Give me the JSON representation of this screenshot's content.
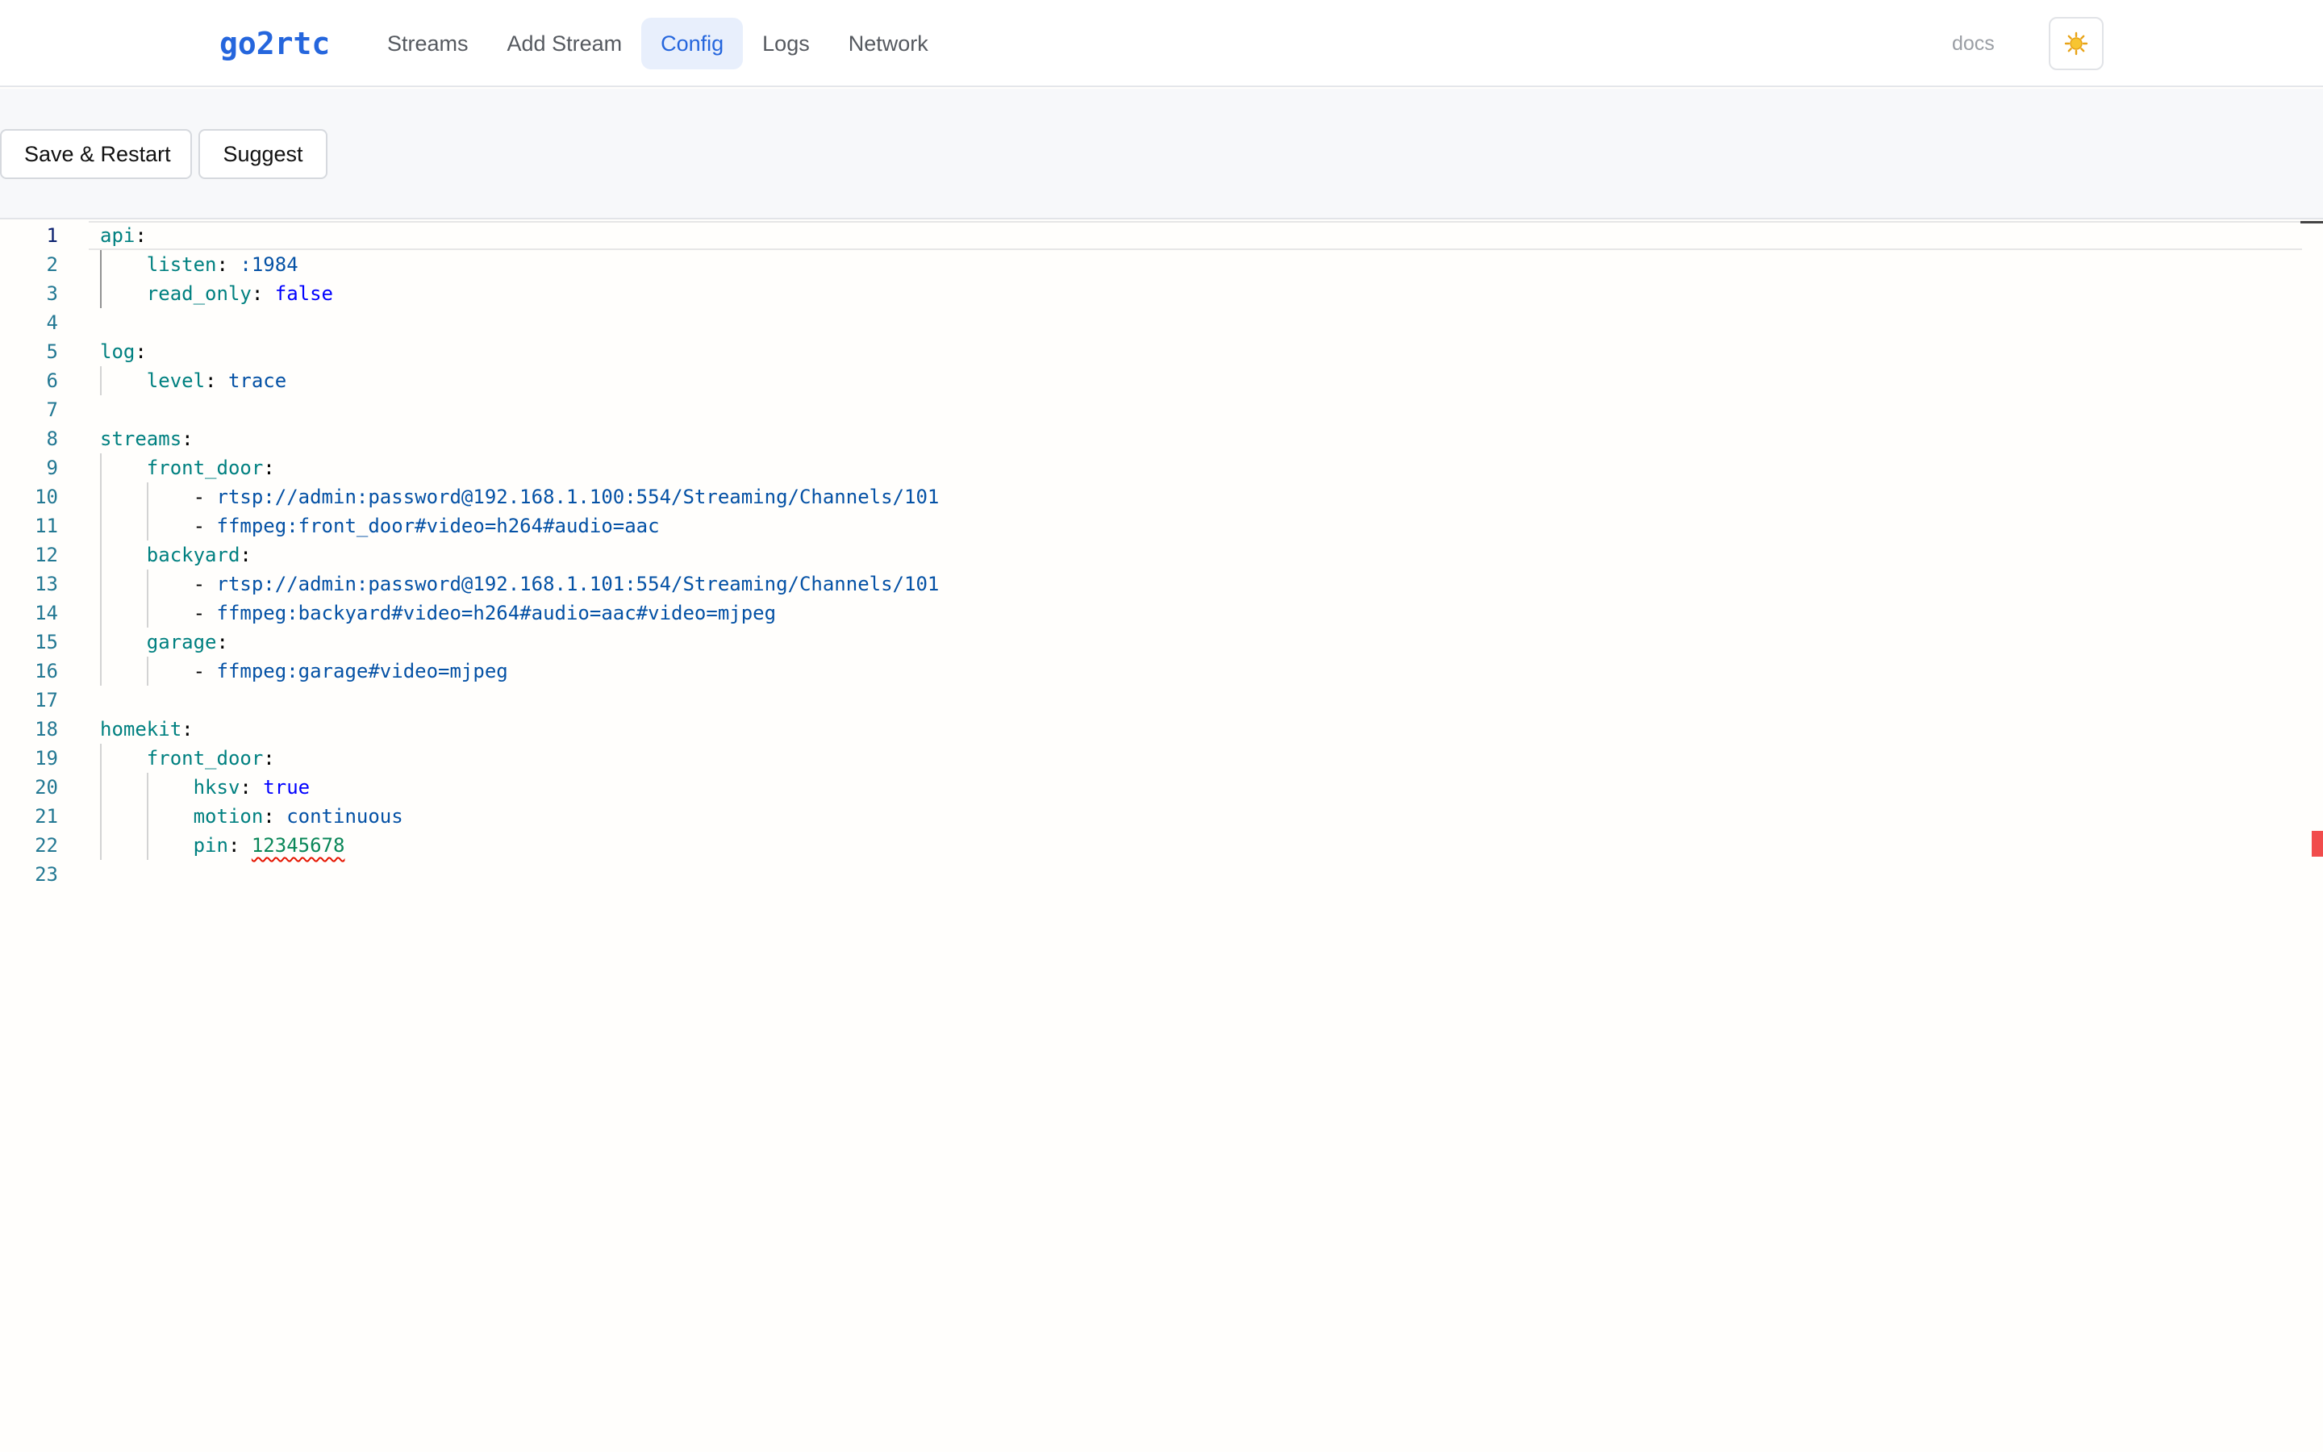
{
  "app": {
    "brand": "go2rtc"
  },
  "nav": {
    "items": [
      {
        "label": "Streams",
        "active": false
      },
      {
        "label": "Add Stream",
        "active": false
      },
      {
        "label": "Config",
        "active": true
      },
      {
        "label": "Logs",
        "active": false
      },
      {
        "label": "Network",
        "active": false
      }
    ],
    "docs_label": "docs",
    "theme_icon": "sun-icon"
  },
  "toolbar": {
    "save_label": "Save & Restart",
    "suggest_label": "Suggest"
  },
  "editor": {
    "current_line": 1,
    "error_line": 22,
    "lines": [
      {
        "n": "1",
        "indent": 0,
        "tokens": [
          {
            "t": "key",
            "v": "api"
          },
          {
            "t": "punc",
            "v": ":"
          }
        ]
      },
      {
        "n": "2",
        "indent": 1,
        "tokens": [
          {
            "t": "key",
            "v": "listen"
          },
          {
            "t": "punc",
            "v": ": "
          },
          {
            "t": "str",
            "v": ":1984"
          }
        ]
      },
      {
        "n": "3",
        "indent": 1,
        "tokens": [
          {
            "t": "key",
            "v": "read_only"
          },
          {
            "t": "punc",
            "v": ": "
          },
          {
            "t": "bool",
            "v": "false"
          }
        ]
      },
      {
        "n": "4",
        "indent": 0,
        "tokens": []
      },
      {
        "n": "5",
        "indent": 0,
        "tokens": [
          {
            "t": "key",
            "v": "log"
          },
          {
            "t": "punc",
            "v": ":"
          }
        ]
      },
      {
        "n": "6",
        "indent": 1,
        "tokens": [
          {
            "t": "key",
            "v": "level"
          },
          {
            "t": "punc",
            "v": ": "
          },
          {
            "t": "str",
            "v": "trace"
          }
        ]
      },
      {
        "n": "7",
        "indent": 0,
        "tokens": []
      },
      {
        "n": "8",
        "indent": 0,
        "tokens": [
          {
            "t": "key",
            "v": "streams"
          },
          {
            "t": "punc",
            "v": ":"
          }
        ]
      },
      {
        "n": "9",
        "indent": 1,
        "tokens": [
          {
            "t": "key",
            "v": "front_door"
          },
          {
            "t": "punc",
            "v": ":"
          }
        ]
      },
      {
        "n": "10",
        "indent": 2,
        "tokens": [
          {
            "t": "punc",
            "v": "- "
          },
          {
            "t": "str",
            "v": "rtsp://admin:password@192.168.1.100:554/Streaming/Channels/101"
          }
        ]
      },
      {
        "n": "11",
        "indent": 2,
        "tokens": [
          {
            "t": "punc",
            "v": "- "
          },
          {
            "t": "str",
            "v": "ffmpeg:front_door#video=h264#audio=aac"
          }
        ]
      },
      {
        "n": "12",
        "indent": 1,
        "tokens": [
          {
            "t": "key",
            "v": "backyard"
          },
          {
            "t": "punc",
            "v": ":"
          }
        ]
      },
      {
        "n": "13",
        "indent": 2,
        "tokens": [
          {
            "t": "punc",
            "v": "- "
          },
          {
            "t": "str",
            "v": "rtsp://admin:password@192.168.1.101:554/Streaming/Channels/101"
          }
        ]
      },
      {
        "n": "14",
        "indent": 2,
        "tokens": [
          {
            "t": "punc",
            "v": "- "
          },
          {
            "t": "str",
            "v": "ffmpeg:backyard#video=h264#audio=aac#video=mjpeg"
          }
        ]
      },
      {
        "n": "15",
        "indent": 1,
        "tokens": [
          {
            "t": "key",
            "v": "garage"
          },
          {
            "t": "punc",
            "v": ":"
          }
        ]
      },
      {
        "n": "16",
        "indent": 2,
        "tokens": [
          {
            "t": "punc",
            "v": "- "
          },
          {
            "t": "str",
            "v": "ffmpeg:garage#video=mjpeg"
          }
        ]
      },
      {
        "n": "17",
        "indent": 0,
        "tokens": []
      },
      {
        "n": "18",
        "indent": 0,
        "tokens": [
          {
            "t": "key",
            "v": "homekit"
          },
          {
            "t": "punc",
            "v": ":"
          }
        ]
      },
      {
        "n": "19",
        "indent": 1,
        "tokens": [
          {
            "t": "key",
            "v": "front_door"
          },
          {
            "t": "punc",
            "v": ":"
          }
        ]
      },
      {
        "n": "20",
        "indent": 2,
        "tokens": [
          {
            "t": "key",
            "v": "hksv"
          },
          {
            "t": "punc",
            "v": ": "
          },
          {
            "t": "bool",
            "v": "true"
          }
        ]
      },
      {
        "n": "21",
        "indent": 2,
        "tokens": [
          {
            "t": "key",
            "v": "motion"
          },
          {
            "t": "punc",
            "v": ": "
          },
          {
            "t": "str",
            "v": "continuous"
          }
        ]
      },
      {
        "n": "22",
        "indent": 2,
        "tokens": [
          {
            "t": "key",
            "v": "pin"
          },
          {
            "t": "punc",
            "v": ": "
          },
          {
            "t": "num",
            "v": "12345678",
            "error": true
          }
        ]
      },
      {
        "n": "23",
        "indent": 0,
        "tokens": []
      }
    ]
  }
}
